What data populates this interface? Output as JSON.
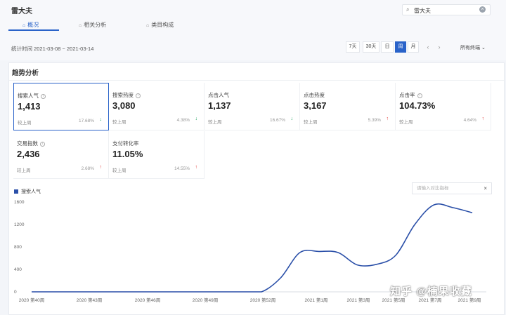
{
  "header": {
    "title": "雷大夫"
  },
  "search": {
    "value": "雷大夫"
  },
  "tabs": [
    {
      "label": "概况",
      "active": true
    },
    {
      "label": "相关分析",
      "active": false
    },
    {
      "label": "类目构成",
      "active": false
    }
  ],
  "toolbar": {
    "date_range": "统计时间 2021-03-08 ~ 2021-03-14",
    "periods": [
      "7天",
      "30天",
      "日",
      "周",
      "月"
    ],
    "selected_period": "周",
    "prev": "‹",
    "next": "›",
    "category": "所有终端"
  },
  "section": {
    "title": "趋势分析"
  },
  "compare_label": "较上周",
  "metrics": [
    {
      "label": "搜索人气",
      "value": "1,413",
      "change": "17.68%",
      "trend": "down",
      "info": true
    },
    {
      "label": "搜索热度",
      "value": "3,080",
      "change": "4.38%",
      "trend": "down",
      "info": true
    },
    {
      "label": "点击人气",
      "value": "1,137",
      "change": "16.67%",
      "trend": "down",
      "info": false
    },
    {
      "label": "点击热度",
      "value": "3,167",
      "change": "5.39%",
      "trend": "up",
      "info": false
    },
    {
      "label": "点击率",
      "value": "104.73%",
      "change": "4.64%",
      "trend": "up",
      "info": true
    },
    {
      "label": "交易指数",
      "value": "2,436",
      "change": "2.68%",
      "trend": "up",
      "info": true
    },
    {
      "label": "支付转化率",
      "value": "11.05%",
      "change": "14.55%",
      "trend": "up",
      "info": false
    }
  ],
  "chart_panel": {
    "add_placeholder": "请输入对比指标",
    "close": "×"
  },
  "colors": {
    "accent": "#2a63c9",
    "line": "#2a4fa8",
    "up": "#e0302d",
    "down": "#19a05a"
  },
  "chart_data": {
    "type": "line",
    "series": [
      {
        "name": "搜索人气"
      }
    ],
    "x_ticks": [
      "2020 第40周",
      "2020 第43周",
      "2020 第46周",
      "2020 第49周",
      "2020 第52周",
      "2021 第1周",
      "2021 第3周",
      "2021 第5周",
      "2021 第7周",
      "2021 第9周"
    ],
    "y_ticks": [
      0,
      400,
      800,
      1200,
      1600
    ],
    "ylim": [
      0,
      1600
    ],
    "x": [
      "2020 第40周",
      "2020 第41周",
      "2020 第42周",
      "2020 第43周",
      "2020 第44周",
      "2020 第45周",
      "2020 第46周",
      "2020 第47周",
      "2020 第48周",
      "2020 第49周",
      "2020 第50周",
      "2020 第51周",
      "2020 第52周",
      "2020 第53周",
      "2021 第1周",
      "2021 第2周",
      "2021 第3周",
      "2021 第4周",
      "2021 第5周",
      "2021 第6周",
      "2021 第7周",
      "2021 第8周",
      "2021 第9周",
      "2021 第10周"
    ],
    "values": [
      0,
      0,
      0,
      0,
      0,
      0,
      0,
      0,
      0,
      0,
      0,
      0,
      0,
      250,
      700,
      720,
      700,
      480,
      490,
      650,
      1200,
      1550,
      1500,
      1410
    ],
    "grid": false,
    "legend": "top-left"
  },
  "watermark": "知乎 @楠果收藏"
}
